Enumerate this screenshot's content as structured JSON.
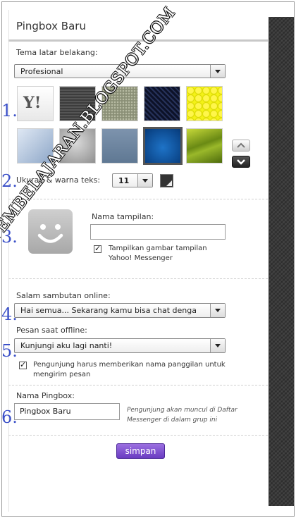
{
  "panel": {
    "title": "Pingbox Baru"
  },
  "theme": {
    "label": "Tema latar belakang:",
    "selected": "Profesional",
    "yahoo_logo": "Y!"
  },
  "text_settings": {
    "label": "Ukuran & warna teks:",
    "size": "11",
    "color": "#333333"
  },
  "display": {
    "label": "Nama tampilan:",
    "value": "",
    "checkbox_label": "Tampilkan gambar tampilan Yahoo! Messenger",
    "checked": true
  },
  "online_greeting": {
    "label": "Salam sambutan online:",
    "value": "Hai semua... Sekarang kamu bisa chat denga"
  },
  "offline_message": {
    "label": "Pesan saat offline:",
    "value": "Kunjungi aku lagi nanti!",
    "checkbox_label": "Pengunjung harus memberikan nama panggilan untuk mengirim pesan",
    "checked": true
  },
  "pingbox_name": {
    "label": "Nama Pingbox:",
    "value": "Pingbox Baru",
    "hint": "Pengunjung akan muncul di Daftar Messenger di dalam grup ini"
  },
  "save_label": "simpan",
  "step_numbers": [
    "1.",
    "2.",
    "3.",
    "4.",
    "5.",
    "6."
  ],
  "watermark": "TUTORIAL-PEMBELAJARAN.BLOGSPOT.COM",
  "colors": {
    "accent": "#6a3cc2",
    "step_numbers": "#3b50c8"
  },
  "icons": {
    "theme_up": "chevron-up-icon",
    "theme_down": "chevron-down-icon",
    "avatar": "smiley-face-icon"
  }
}
